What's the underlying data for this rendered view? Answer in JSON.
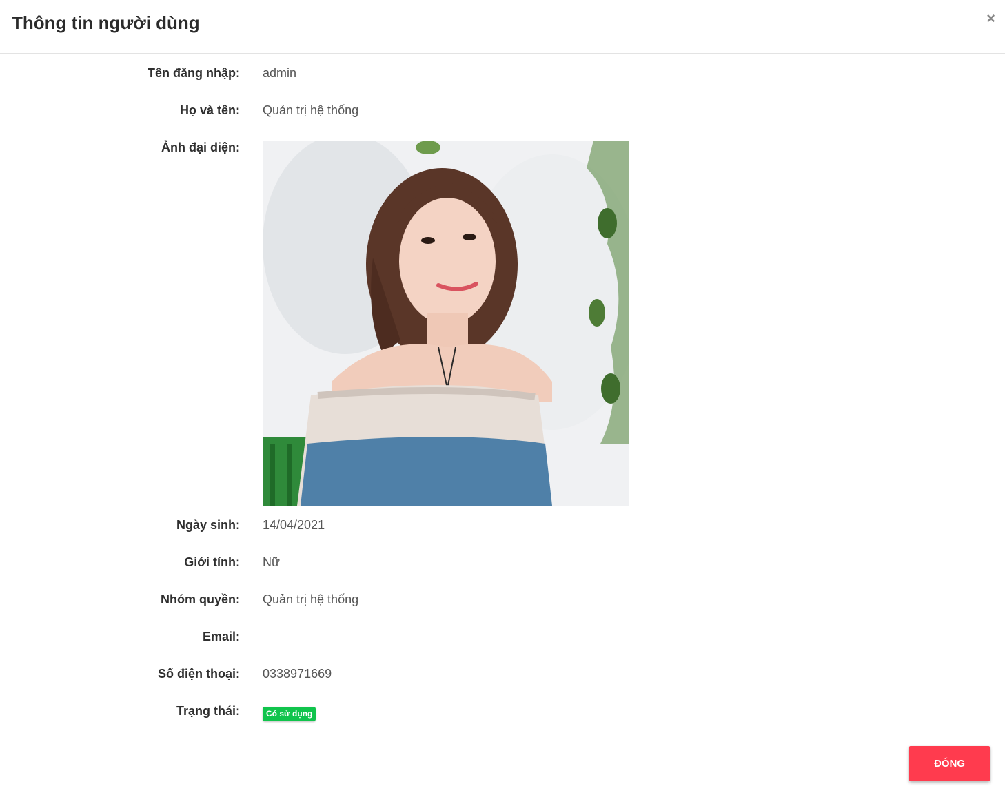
{
  "header": {
    "title": "Thông tin người dùng",
    "close_symbol": "×"
  },
  "fields": {
    "username": {
      "label": "Tên đăng nhập:",
      "value": "admin"
    },
    "fullname": {
      "label": "Họ và tên:",
      "value": "Quản trị hệ thống"
    },
    "avatar": {
      "label": "Ảnh đại diện:"
    },
    "birthday": {
      "label": "Ngày sinh:",
      "value": "14/04/2021"
    },
    "gender": {
      "label": "Giới tính:",
      "value": "Nữ"
    },
    "role": {
      "label": "Nhóm quyền:",
      "value": "Quản trị hệ thống"
    },
    "email": {
      "label": "Email:",
      "value": ""
    },
    "phone": {
      "label": "Số điện thoại:",
      "value": "0338971669"
    },
    "status": {
      "label": "Trạng thái:",
      "value": "Có sử dụng",
      "color": "#10c44c"
    }
  },
  "footer": {
    "close_label": "ĐÓNG",
    "close_color": "#ff3b4e"
  }
}
